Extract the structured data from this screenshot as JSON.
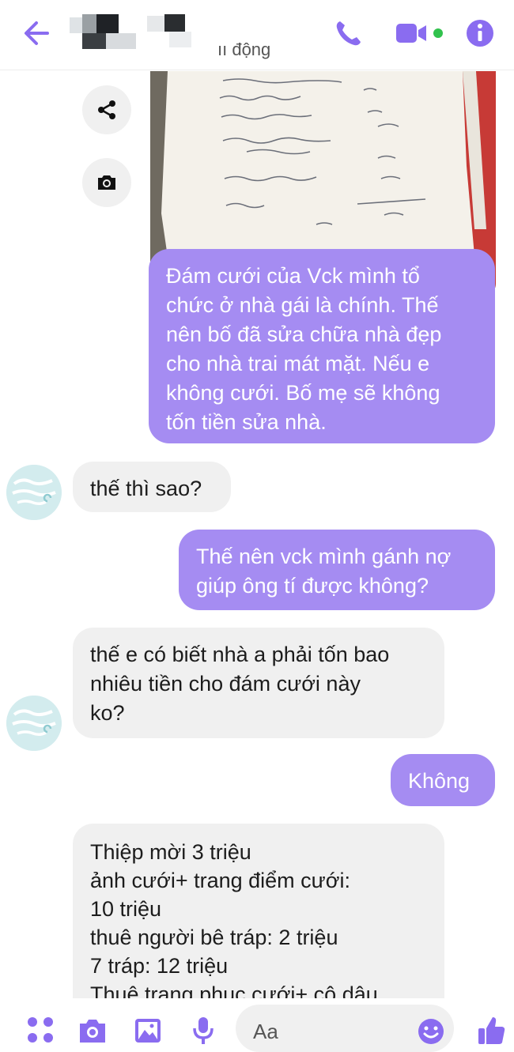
{
  "header": {
    "status_text": "ıı động"
  },
  "messages": [
    {
      "id": "m1",
      "direction": "outgoing",
      "text": "Đám cưới của Vck mình tổ\nchức ở nhà gái là chính. Thế\nnên bố đã sửa chữa nhà đẹp\ncho nhà trai mát mặt. Nếu e\nkhông cưới. Bố mẹ sẽ không\ntốn tiền sửa nhà."
    },
    {
      "id": "m2",
      "direction": "incoming",
      "text": "thế thì sao?"
    },
    {
      "id": "m3",
      "direction": "outgoing",
      "text": "Thế nên vck mình gánh nợ\ngiúp ông tí được không?"
    },
    {
      "id": "m4",
      "direction": "incoming",
      "text": "thế e có biết nhà a phải tốn bao\nnhiêu tiền cho đám cưới này\nko?"
    },
    {
      "id": "m5",
      "direction": "outgoing",
      "text": "Không"
    },
    {
      "id": "m6",
      "direction": "incoming",
      "text": "Thiệp mời    3 triệu\nảnh cưới+ trang điểm cưới:\n10 triệu\nthuê người bê tráp:    2 triệu\n7 tráp:    12 triệu\nThuê trang phục cưới+ cô dâu"
    }
  ],
  "composer": {
    "placeholder": "Aa"
  },
  "icons": {
    "back": "back-arrow-icon",
    "call": "phone-icon",
    "video": "video-call-icon",
    "info": "info-icon",
    "share": "share-icon",
    "camera": "camera-icon",
    "menu": "four-dots-icon",
    "gallery": "image-icon",
    "mic": "microphone-icon",
    "emoji": "emoji-icon",
    "like": "thumbs-up-icon"
  },
  "colors": {
    "accent": "#8a6cf0",
    "outgoing_bubble": "#a58cf2",
    "incoming_bubble": "#f0f0f0",
    "online": "#31c24d"
  }
}
